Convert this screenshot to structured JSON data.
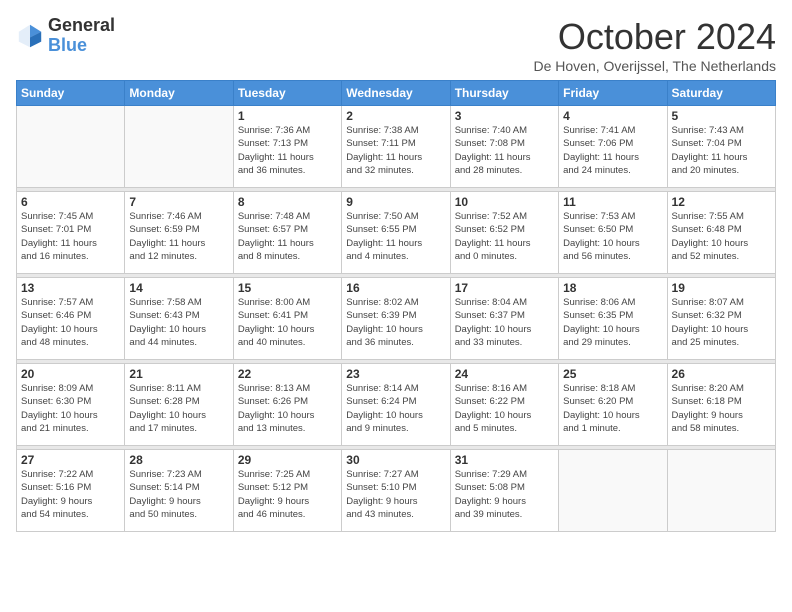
{
  "header": {
    "logo_general": "General",
    "logo_blue": "Blue",
    "month_title": "October 2024",
    "location": "De Hoven, Overijssel, The Netherlands"
  },
  "days_of_week": [
    "Sunday",
    "Monday",
    "Tuesday",
    "Wednesday",
    "Thursday",
    "Friday",
    "Saturday"
  ],
  "weeks": [
    [
      {
        "day": "",
        "info": ""
      },
      {
        "day": "",
        "info": ""
      },
      {
        "day": "1",
        "info": "Sunrise: 7:36 AM\nSunset: 7:13 PM\nDaylight: 11 hours\nand 36 minutes."
      },
      {
        "day": "2",
        "info": "Sunrise: 7:38 AM\nSunset: 7:11 PM\nDaylight: 11 hours\nand 32 minutes."
      },
      {
        "day": "3",
        "info": "Sunrise: 7:40 AM\nSunset: 7:08 PM\nDaylight: 11 hours\nand 28 minutes."
      },
      {
        "day": "4",
        "info": "Sunrise: 7:41 AM\nSunset: 7:06 PM\nDaylight: 11 hours\nand 24 minutes."
      },
      {
        "day": "5",
        "info": "Sunrise: 7:43 AM\nSunset: 7:04 PM\nDaylight: 11 hours\nand 20 minutes."
      }
    ],
    [
      {
        "day": "6",
        "info": "Sunrise: 7:45 AM\nSunset: 7:01 PM\nDaylight: 11 hours\nand 16 minutes."
      },
      {
        "day": "7",
        "info": "Sunrise: 7:46 AM\nSunset: 6:59 PM\nDaylight: 11 hours\nand 12 minutes."
      },
      {
        "day": "8",
        "info": "Sunrise: 7:48 AM\nSunset: 6:57 PM\nDaylight: 11 hours\nand 8 minutes."
      },
      {
        "day": "9",
        "info": "Sunrise: 7:50 AM\nSunset: 6:55 PM\nDaylight: 11 hours\nand 4 minutes."
      },
      {
        "day": "10",
        "info": "Sunrise: 7:52 AM\nSunset: 6:52 PM\nDaylight: 11 hours\nand 0 minutes."
      },
      {
        "day": "11",
        "info": "Sunrise: 7:53 AM\nSunset: 6:50 PM\nDaylight: 10 hours\nand 56 minutes."
      },
      {
        "day": "12",
        "info": "Sunrise: 7:55 AM\nSunset: 6:48 PM\nDaylight: 10 hours\nand 52 minutes."
      }
    ],
    [
      {
        "day": "13",
        "info": "Sunrise: 7:57 AM\nSunset: 6:46 PM\nDaylight: 10 hours\nand 48 minutes."
      },
      {
        "day": "14",
        "info": "Sunrise: 7:58 AM\nSunset: 6:43 PM\nDaylight: 10 hours\nand 44 minutes."
      },
      {
        "day": "15",
        "info": "Sunrise: 8:00 AM\nSunset: 6:41 PM\nDaylight: 10 hours\nand 40 minutes."
      },
      {
        "day": "16",
        "info": "Sunrise: 8:02 AM\nSunset: 6:39 PM\nDaylight: 10 hours\nand 36 minutes."
      },
      {
        "day": "17",
        "info": "Sunrise: 8:04 AM\nSunset: 6:37 PM\nDaylight: 10 hours\nand 33 minutes."
      },
      {
        "day": "18",
        "info": "Sunrise: 8:06 AM\nSunset: 6:35 PM\nDaylight: 10 hours\nand 29 minutes."
      },
      {
        "day": "19",
        "info": "Sunrise: 8:07 AM\nSunset: 6:32 PM\nDaylight: 10 hours\nand 25 minutes."
      }
    ],
    [
      {
        "day": "20",
        "info": "Sunrise: 8:09 AM\nSunset: 6:30 PM\nDaylight: 10 hours\nand 21 minutes."
      },
      {
        "day": "21",
        "info": "Sunrise: 8:11 AM\nSunset: 6:28 PM\nDaylight: 10 hours\nand 17 minutes."
      },
      {
        "day": "22",
        "info": "Sunrise: 8:13 AM\nSunset: 6:26 PM\nDaylight: 10 hours\nand 13 minutes."
      },
      {
        "day": "23",
        "info": "Sunrise: 8:14 AM\nSunset: 6:24 PM\nDaylight: 10 hours\nand 9 minutes."
      },
      {
        "day": "24",
        "info": "Sunrise: 8:16 AM\nSunset: 6:22 PM\nDaylight: 10 hours\nand 5 minutes."
      },
      {
        "day": "25",
        "info": "Sunrise: 8:18 AM\nSunset: 6:20 PM\nDaylight: 10 hours\nand 1 minute."
      },
      {
        "day": "26",
        "info": "Sunrise: 8:20 AM\nSunset: 6:18 PM\nDaylight: 9 hours\nand 58 minutes."
      }
    ],
    [
      {
        "day": "27",
        "info": "Sunrise: 7:22 AM\nSunset: 5:16 PM\nDaylight: 9 hours\nand 54 minutes."
      },
      {
        "day": "28",
        "info": "Sunrise: 7:23 AM\nSunset: 5:14 PM\nDaylight: 9 hours\nand 50 minutes."
      },
      {
        "day": "29",
        "info": "Sunrise: 7:25 AM\nSunset: 5:12 PM\nDaylight: 9 hours\nand 46 minutes."
      },
      {
        "day": "30",
        "info": "Sunrise: 7:27 AM\nSunset: 5:10 PM\nDaylight: 9 hours\nand 43 minutes."
      },
      {
        "day": "31",
        "info": "Sunrise: 7:29 AM\nSunset: 5:08 PM\nDaylight: 9 hours\nand 39 minutes."
      },
      {
        "day": "",
        "info": ""
      },
      {
        "day": "",
        "info": ""
      }
    ]
  ]
}
